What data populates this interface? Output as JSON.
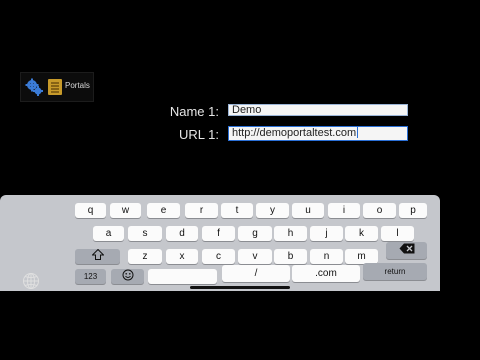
{
  "toolbar": {
    "portals_label": "Portals"
  },
  "form": {
    "name_label": "Name 1:",
    "name_value": "Demo",
    "url_label": "URL 1:",
    "url_value": "http://demoportaltest.com"
  },
  "keyboard": {
    "row1": [
      "q",
      "w",
      "e",
      "r",
      "t",
      "y",
      "u",
      "i",
      "o",
      "p"
    ],
    "row2": [
      "a",
      "s",
      "d",
      "f",
      "g",
      "h",
      "j",
      "k",
      "l"
    ],
    "row3": [
      "z",
      "x",
      "c",
      "v",
      "b",
      "n",
      "m"
    ],
    "numbers_label": "123",
    "slash_label": "/",
    "dotcom_label": ".com",
    "return_label": "return"
  },
  "colors": {
    "background": "#000000",
    "keyboard_bg": "#c5c7cc",
    "key_light": "#fbfbfb",
    "key_dark": "#a6aab2",
    "focus_border": "#2a6fd6"
  }
}
